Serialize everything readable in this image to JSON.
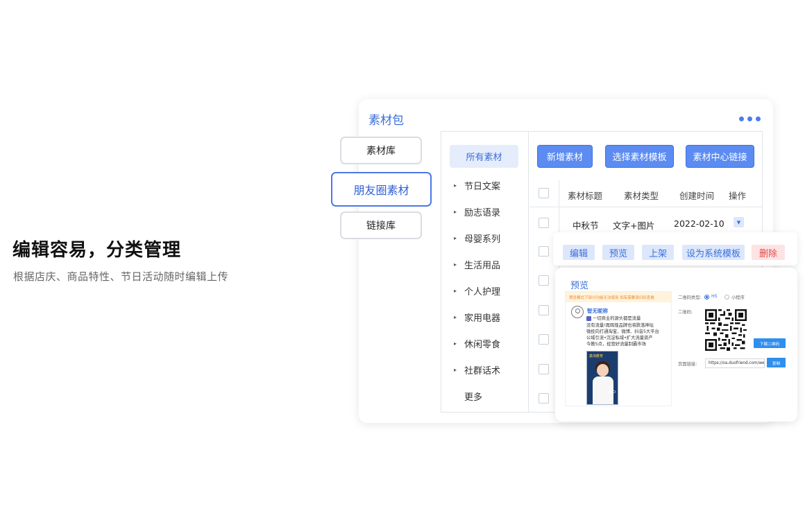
{
  "hero": {
    "headline": "编辑容易，分类管理",
    "subline": "根据店庆、商品特性、节日活动随时编辑上传"
  },
  "side_tabs": [
    "素材库",
    "朋友圈素材",
    "链接库"
  ],
  "side_tab_active": "朋友圈素材",
  "app": {
    "title": "素材包",
    "menu_icon": "more-dots-icon"
  },
  "categories": {
    "active": "所有素材",
    "items": [
      "节日文案",
      "励志语录",
      "母婴系列",
      "生活用品",
      "个人护理",
      "家用电器",
      "休闲零食",
      "社群话术"
    ],
    "more": "更多"
  },
  "toolbar": {
    "add": "新增素材",
    "choose_template": "选择素材模板",
    "center_link": "素材中心链接"
  },
  "table": {
    "headers": [
      "素材标题",
      "素材类型",
      "创建时间",
      "操作"
    ],
    "rows": [
      {
        "title": "中秋节",
        "type": "文字+图片",
        "date": "2022-02-10"
      }
    ]
  },
  "row_actions": {
    "edit": "编辑",
    "preview": "预览",
    "publish": "上架",
    "set_template": "设为系统模板",
    "delete": "删除"
  },
  "preview": {
    "title": "预览",
    "banner": "预览模式下部分功能无法使用  如有需要请扫码查看",
    "username": "智无昵称",
    "lines": [
      "一切商业的源头都是流量",
      "没有流量!再辉煌品牌也将跌落神坛",
      "微投向打通淘宝、微博、抖音5大平台",
      "公域引流•沉淀私域•扩大流量资产",
      "今教5点，经营好流量制霸市场"
    ],
    "poster_title": "鑫淘教育",
    "poster_logo": "UIAO",
    "qr_type_label": "二维码类型:",
    "qr_options": [
      "H5",
      "小程序"
    ],
    "qr_label": "二维码:",
    "download": "下载二维码",
    "link_label": "页面链接:",
    "link_value": "https://oa.duofriend.com/wel",
    "copy": "复制"
  },
  "colors": {
    "accent": "#4a7cf0",
    "danger": "#e34848",
    "button": "#5c8cf2"
  }
}
